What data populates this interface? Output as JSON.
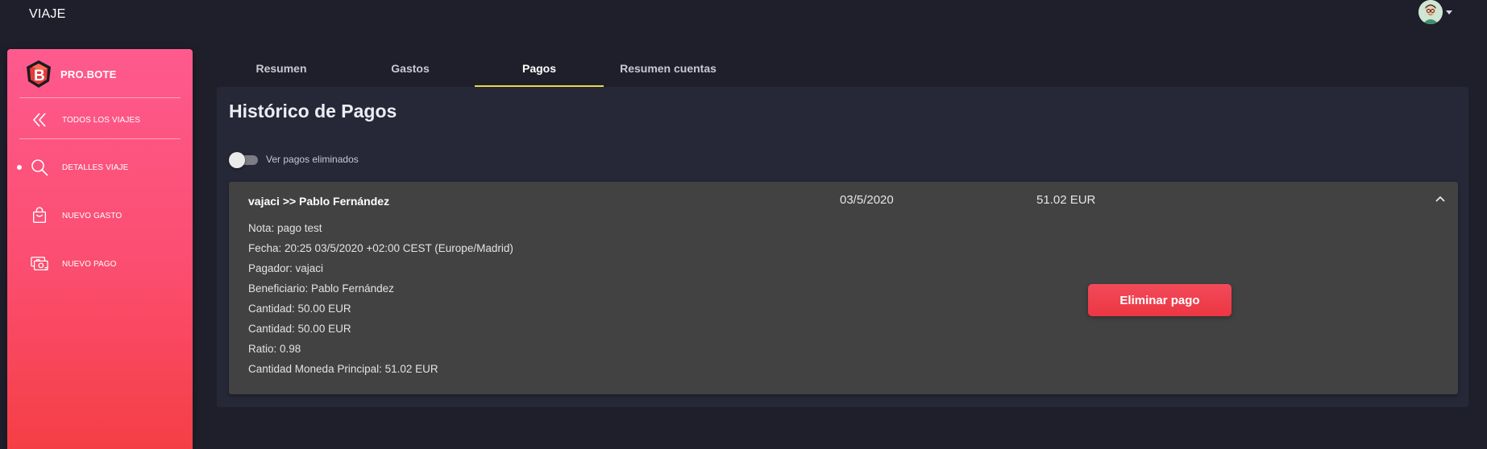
{
  "app": {
    "title": "VIAJE"
  },
  "user": {
    "avatar_icon": "user-avatar-icon"
  },
  "sidebar": {
    "brand": "PRO.BOTE",
    "items": [
      {
        "label": "TODOS LOS VIAJES",
        "icon": "chevrons-left-icon",
        "active": false
      },
      {
        "label": "DETALLES VIAJE",
        "icon": "search-icon",
        "active": true
      },
      {
        "label": "NUEVO GASTO",
        "icon": "shopping-bag-icon",
        "active": false
      },
      {
        "label": "NUEVO PAGO",
        "icon": "money-icon",
        "active": false
      }
    ]
  },
  "tabs": [
    {
      "label": "Resumen",
      "active": false
    },
    {
      "label": "Gastos",
      "active": false
    },
    {
      "label": "Pagos",
      "active": true
    },
    {
      "label": "Resumen cuentas",
      "active": false
    }
  ],
  "main": {
    "title": "Histórico de Pagos",
    "toggle_label": "Ver pagos eliminados",
    "toggle_on": false
  },
  "payment": {
    "title": "vajaci >> Pablo Fernández",
    "date": "03/5/2020",
    "amount": "51.02 EUR",
    "details": [
      "Nota: pago test",
      "Fecha: 20:25 03/5/2020 +02:00 CEST (Europe/Madrid)",
      "Pagador: vajaci",
      "Beneficiario: Pablo Fernández",
      "Cantidad: 50.00 EUR",
      "Cantidad: 50.00 EUR",
      "Ratio: 0.98",
      "Cantidad Moneda Principal: 51.02 EUR"
    ],
    "delete_label": "Eliminar pago"
  },
  "colors": {
    "background": "#1e1f2b",
    "card": "#262838",
    "panel": "#424242",
    "sidebar_top": "#fe5a8e",
    "sidebar_bottom": "#f53f45",
    "tab_indicator": "#e8d94a",
    "danger": "#ec3642"
  }
}
